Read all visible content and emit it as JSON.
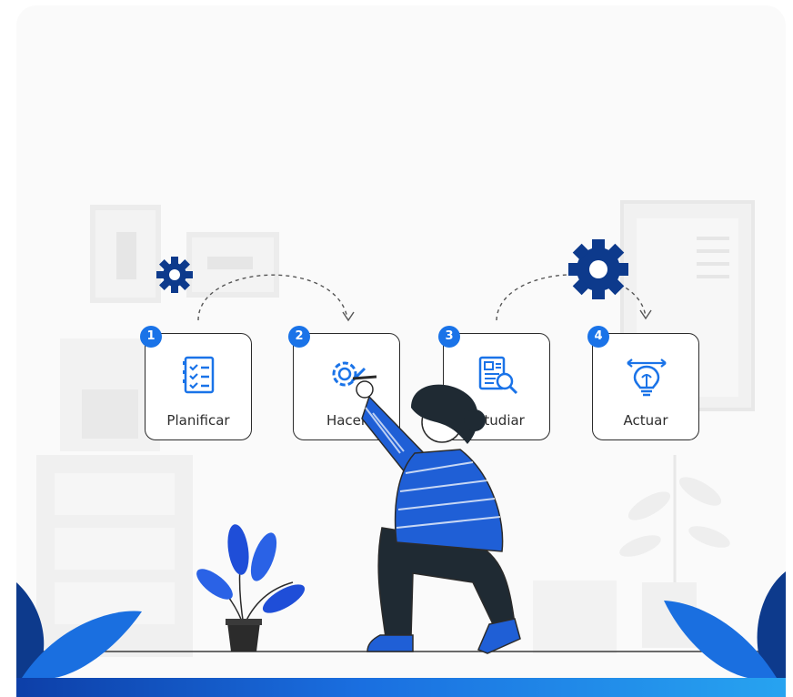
{
  "diagram": {
    "steps": [
      {
        "number": "1",
        "label": "Planificar",
        "icon": "checklist-icon"
      },
      {
        "number": "2",
        "label": "Hacer",
        "icon": "gear-pencil-icon"
      },
      {
        "number": "3",
        "label": "Estudiar",
        "icon": "document-magnifier-icon"
      },
      {
        "number": "4",
        "label": "Actuar",
        "icon": "lightbulb-arrows-icon"
      }
    ]
  },
  "colors": {
    "accent_blue": "#1a73e8",
    "dark_navy": "#0d3a8c",
    "outline": "#2b2b2b",
    "footer_gradient_start": "#0d3fa8",
    "footer_gradient_end": "#27a3f0"
  }
}
